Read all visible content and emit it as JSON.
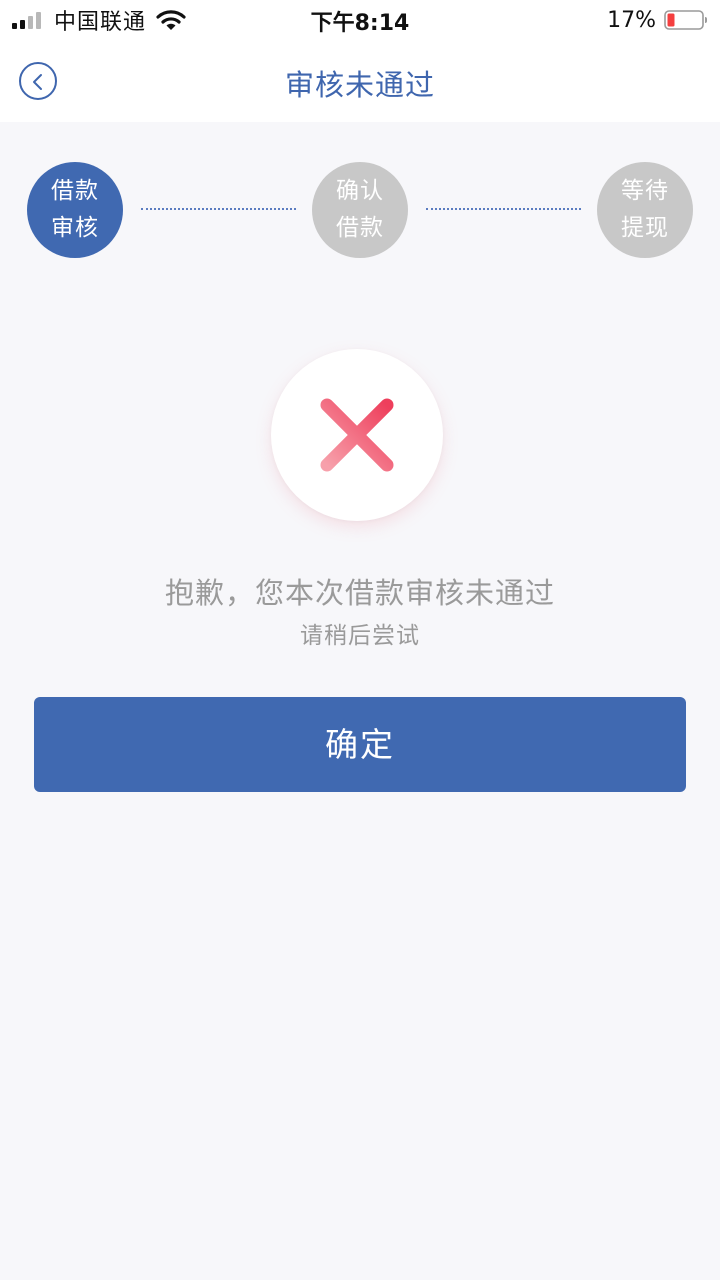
{
  "status_bar": {
    "carrier": "中国联通",
    "time": "下午8:14",
    "battery": "17%"
  },
  "nav": {
    "title": "审核未通过",
    "back_icon": "chevron-left-icon"
  },
  "steps": [
    {
      "line1": "借款",
      "line2": "审核",
      "state": "active"
    },
    {
      "line1": "确认",
      "line2": "借款",
      "state": "inactive"
    },
    {
      "line1": "等待",
      "line2": "提现",
      "state": "inactive"
    }
  ],
  "result": {
    "icon": "error-x-icon",
    "title": "抱歉，您本次借款审核未通过",
    "subtitle": "请稍后尝试"
  },
  "confirm_button": {
    "label": "确定"
  },
  "colors": {
    "primary": "#4069b1",
    "inactive_step": "#c8c8c8",
    "error": "#f05a72",
    "muted_text": "#9a9a9a",
    "background": "#f7f7fa"
  }
}
